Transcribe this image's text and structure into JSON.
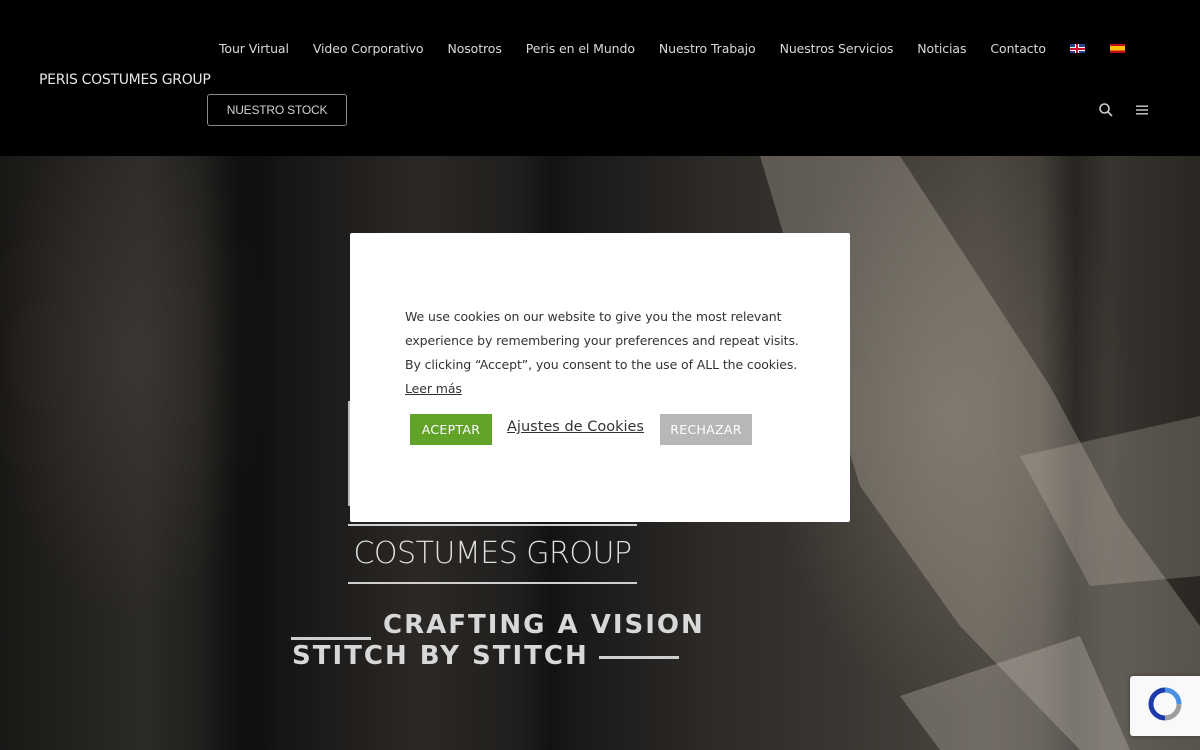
{
  "header": {
    "logo_text": "PERIS COSTUMES GROUP",
    "nav": [
      {
        "label": "Tour Virtual"
      },
      {
        "label": "Video Corporativo"
      },
      {
        "label": "Nosotros"
      },
      {
        "label": "Peris en el Mundo"
      },
      {
        "label": "Nuestro Trabajo"
      },
      {
        "label": "Nuestros Servicios"
      },
      {
        "label": "Noticias"
      },
      {
        "label": "Contacto"
      }
    ],
    "languages": [
      {
        "icon": "flag-en-icon"
      },
      {
        "icon": "flag-es-icon"
      }
    ],
    "stock_button": "NUESTRO STOCK",
    "icons": [
      "search-icon",
      "menu-icon"
    ]
  },
  "hero": {
    "brand": "COSTUMES GROUP",
    "tagline_line1": "CRAFTING A VISION",
    "tagline_line2": "STITCH BY STITCH"
  },
  "cookie_modal": {
    "message": "We use cookies on our website to give you the most relevant experience by remembering your preferences and repeat visits. By clicking “Accept”, you consent to the use of ALL the cookies.",
    "read_more": "Leer más",
    "accept_label": "ACEPTAR",
    "settings_label": "Ajustes de Cookies",
    "reject_label": "RECHAZAR",
    "accept_color": "#61a229",
    "reject_color": "#b7b7b7"
  },
  "recaptcha": {
    "icon": "recaptcha-icon"
  }
}
